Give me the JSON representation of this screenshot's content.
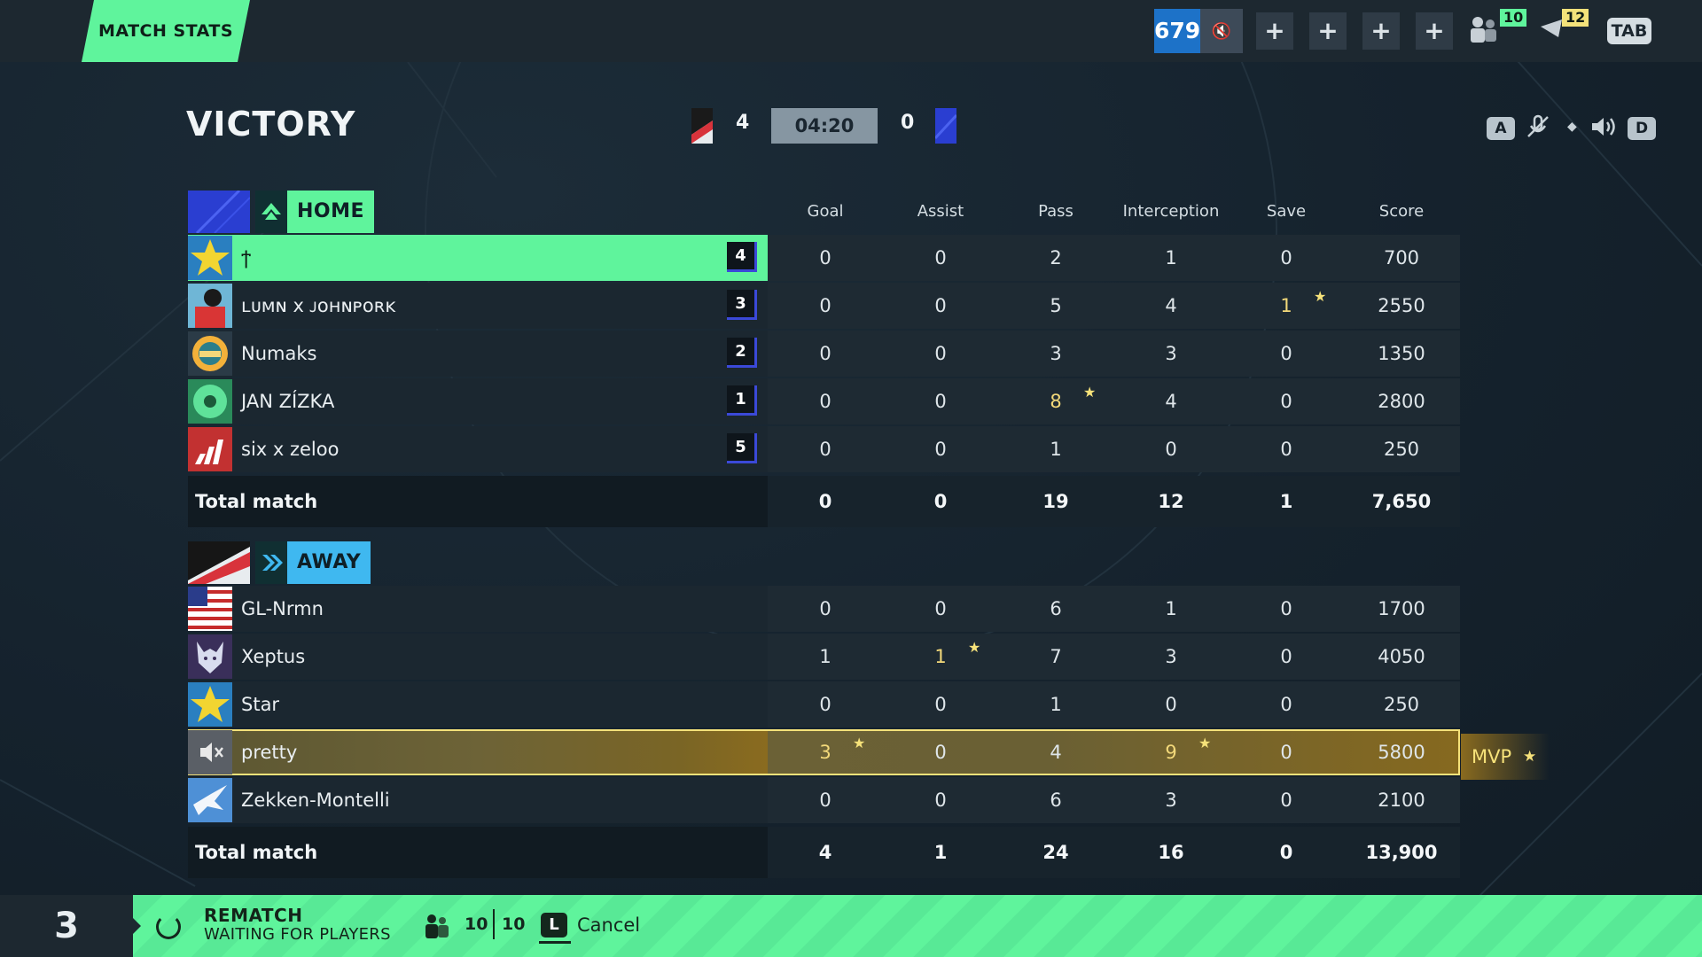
{
  "header": {
    "tab_title": "MATCH STATS",
    "points": "679",
    "party_count": "10",
    "message_count": "12",
    "tab_key": "TAB",
    "plus": "+"
  },
  "scoreboard": {
    "result": "VICTORY",
    "home_score": "4",
    "timer": "04:20",
    "away_score": "0",
    "key_left": "A",
    "key_right": "D"
  },
  "columns": [
    "Goal",
    "Assist",
    "Pass",
    "Interception",
    "Save",
    "Score"
  ],
  "home": {
    "label": "HOME",
    "color": "#2a3ed1",
    "accent": "#5ff49c",
    "players": [
      {
        "name": "ϯ",
        "position": "4",
        "stats": [
          "0",
          "0",
          "2",
          "1",
          "0",
          "700"
        ],
        "highlight": [],
        "is_me": true
      },
      {
        "name": "ʟᴜᴍɴ x ᴊᴏʜɴᴘᴏʀᴋ",
        "position": "3",
        "stats": [
          "0",
          "0",
          "5",
          "4",
          "1",
          "2550"
        ],
        "highlight": [
          4
        ]
      },
      {
        "name": "Numaks",
        "position": "2",
        "stats": [
          "0",
          "0",
          "3",
          "3",
          "0",
          "1350"
        ],
        "highlight": []
      },
      {
        "name": "JAN ZÍZKA",
        "position": "1",
        "stats": [
          "0",
          "0",
          "8",
          "4",
          "0",
          "2800"
        ],
        "highlight": [
          2
        ]
      },
      {
        "name": "six x zeloo",
        "position": "5",
        "stats": [
          "0",
          "0",
          "1",
          "0",
          "0",
          "250"
        ],
        "highlight": []
      }
    ],
    "total_label": "Total match",
    "totals": [
      "0",
      "0",
      "19",
      "12",
      "1",
      "7,650"
    ]
  },
  "away": {
    "label": "AWAY",
    "accent": "#3fb8f0",
    "players": [
      {
        "name": "GL-Nrmn",
        "stats": [
          "0",
          "0",
          "6",
          "1",
          "0",
          "1700"
        ],
        "highlight": []
      },
      {
        "name": "Xeptus",
        "stats": [
          "1",
          "1",
          "7",
          "3",
          "0",
          "4050"
        ],
        "highlight": [
          1
        ]
      },
      {
        "name": "Star",
        "stats": [
          "0",
          "0",
          "1",
          "0",
          "0",
          "250"
        ],
        "highlight": []
      },
      {
        "name": "pretty",
        "stats": [
          "3",
          "0",
          "4",
          "9",
          "0",
          "5800"
        ],
        "highlight": [
          0,
          3
        ],
        "mvp": true
      },
      {
        "name": "Zekken-Montelli",
        "stats": [
          "0",
          "0",
          "6",
          "3",
          "0",
          "2100"
        ],
        "highlight": []
      }
    ],
    "total_label": "Total match",
    "totals": [
      "4",
      "1",
      "24",
      "16",
      "0",
      "13,900"
    ]
  },
  "mvp_label": "MVP",
  "footer": {
    "countdown": "3",
    "rematch_title": "REMATCH",
    "rematch_status": "WAITING FOR PLAYERS",
    "ready_count": "10",
    "total_count": "10",
    "cancel_key": "L",
    "cancel_label": "Cancel"
  }
}
